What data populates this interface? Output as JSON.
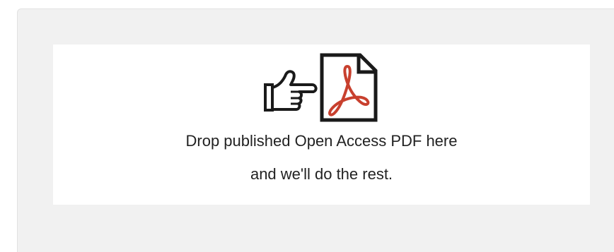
{
  "dropzone": {
    "icons": [
      "pointing-hand-icon",
      "pdf-document-icon"
    ],
    "line1": "Drop published Open Access PDF here",
    "line2": "and we'll do the rest."
  },
  "colors": {
    "panel_background": "#f1f1f1",
    "dropzone_background": "#ffffff",
    "text": "#222222",
    "icon": "#1a1a1a"
  }
}
